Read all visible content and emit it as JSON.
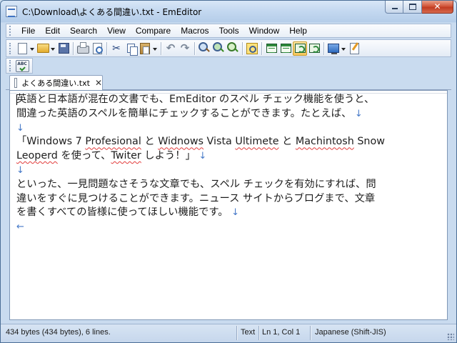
{
  "window": {
    "title": "C:\\Download\\よくある間違い.txt - EmEditor",
    "close_glyph": "✕"
  },
  "menu": [
    "File",
    "Edit",
    "Search",
    "View",
    "Compare",
    "Macros",
    "Tools",
    "Window",
    "Help"
  ],
  "toolbar": {
    "icons": [
      "new-icon",
      "open-icon",
      "save-icon",
      "print-icon",
      "print-preview-icon",
      "cut-icon",
      "copy-icon",
      "paste-icon",
      "undo-icon",
      "redo-icon",
      "find-icon",
      "find-next-icon",
      "replace-icon",
      "highlight-icon",
      "output-bar-icon",
      "word-wrap-icon",
      "full-screen-icon",
      "properties-icon",
      "spell-check-icon"
    ],
    "spell_label": "ABC"
  },
  "tab": {
    "label": "よくある間違い.txt",
    "close": "✕"
  },
  "editor": {
    "lines": [
      "英語と日本語が混在の文書でも、EmEditor のスペル チェック機能を使うと、",
      "間違った英語のスペルを簡単にチェックすることができます。たとえば、",
      "",
      "「Windows 7 Profesional と Widnows Vista Ultimete と Machintosh Snow",
      "Leoperd を使って、Twiter しよう！」",
      "",
      "といった、一見問題なさそうな文章でも、スペル チェックを有効にすれば、問",
      "違いをすぐに見つけることができます。ニュース サイトからブログまで、文章",
      "を書くすべての皆様に使ってほしい機能です。"
    ],
    "newline_mark": "↓",
    "eof_mark": "←",
    "misspelled": [
      "Profesional",
      "Widnows",
      "Ultimete",
      "Machintosh",
      "Leoperd",
      "Twiter"
    ]
  },
  "status": {
    "size": "434 bytes (434 bytes), 6 lines.",
    "mode": "Text",
    "position": "Ln 1, Col 1",
    "encoding": "Japanese (Shift-JIS)"
  },
  "colors": {
    "misspelled_underline": "#e23b3b",
    "marks": "#4679c8",
    "frame": "#b9d1ec"
  }
}
